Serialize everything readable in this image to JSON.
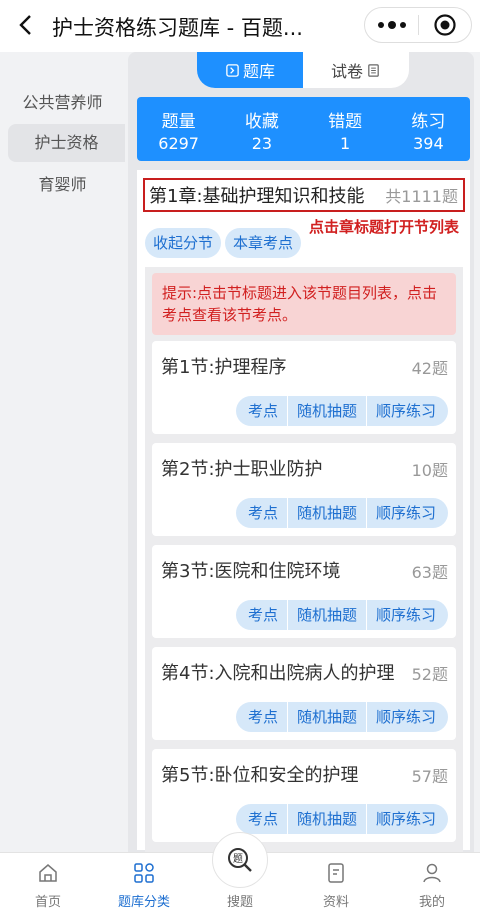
{
  "header": {
    "title": "护士资格练习题库 - 百题..."
  },
  "sidebar": {
    "items": [
      {
        "label": "公共营养师"
      },
      {
        "label": "护士资格"
      },
      {
        "label": "育婴师"
      }
    ]
  },
  "tabs": [
    {
      "label": "题库"
    },
    {
      "label": "试卷"
    }
  ],
  "stats": [
    {
      "label": "题量",
      "value": "6297"
    },
    {
      "label": "收藏",
      "value": "23"
    },
    {
      "label": "错题",
      "value": "1"
    },
    {
      "label": "练习",
      "value": "394"
    }
  ],
  "chapter": {
    "title": "第1章:基础护理知识和技能",
    "count": "共1111题"
  },
  "annotation": "点击章标题打开节列表",
  "chapter_buttons": {
    "collapse": "收起分节",
    "points": "本章考点"
  },
  "tip": "提示:点击节标题进入该节题目列表，点击考点查看该节考点。",
  "section_buttons": {
    "points": "考点",
    "random": "随机抽题",
    "sequential": "顺序练习"
  },
  "sections": [
    {
      "title": "第1节:护理程序",
      "count": "42题"
    },
    {
      "title": "第2节:护士职业防护",
      "count": "10题"
    },
    {
      "title": "第3节:医院和住院环境",
      "count": "63题"
    },
    {
      "title": "第4节:入院和出院病人的护理",
      "count": "52题"
    },
    {
      "title": "第5节:卧位和安全的护理",
      "count": "57题"
    }
  ],
  "bottom_nav": [
    {
      "label": "首页",
      "icon": "home-icon"
    },
    {
      "label": "题库分类",
      "icon": "category-icon"
    },
    {
      "label": "搜题",
      "icon": "search-question-icon"
    },
    {
      "label": "资料",
      "icon": "document-icon"
    },
    {
      "label": "我的",
      "icon": "user-icon"
    }
  ],
  "colors": {
    "primary": "#1e90ff",
    "alert": "#d12020",
    "tip_bg": "#f8d4d4",
    "pill_bg": "#d6e8f9"
  }
}
